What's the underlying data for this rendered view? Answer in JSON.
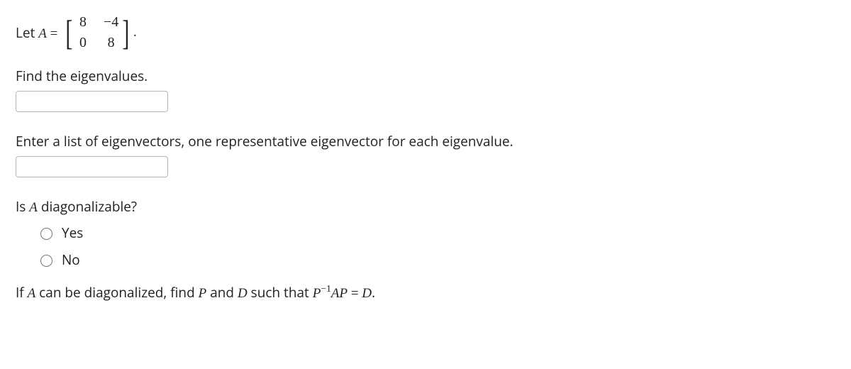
{
  "q1": {
    "prefix": "Let ",
    "var": "A",
    "equals": " = ",
    "matrix": [
      [
        "8",
        "−4"
      ],
      [
        "0",
        "8"
      ]
    ],
    "period": "."
  },
  "q2": {
    "prompt": "Find the eigenvalues."
  },
  "q3": {
    "prompt": "Enter a list of eigenvectors, one representative eigenvector for each eigenvalue."
  },
  "q4": {
    "prompt_pre": "Is ",
    "prompt_var": "A",
    "prompt_post": " diagonalizable?",
    "opt_yes": "Yes",
    "opt_no": "No"
  },
  "q5": {
    "t1": "If ",
    "A": "A",
    "t2": " can be diagonalized, find ",
    "P": "P",
    "t3": " and ",
    "D": "D",
    "t4": " such that ",
    "P2": "P",
    "inv": "−1",
    "A2": "A",
    "P3": "P",
    "eq": " = ",
    "D2": "D",
    "t5": "."
  }
}
